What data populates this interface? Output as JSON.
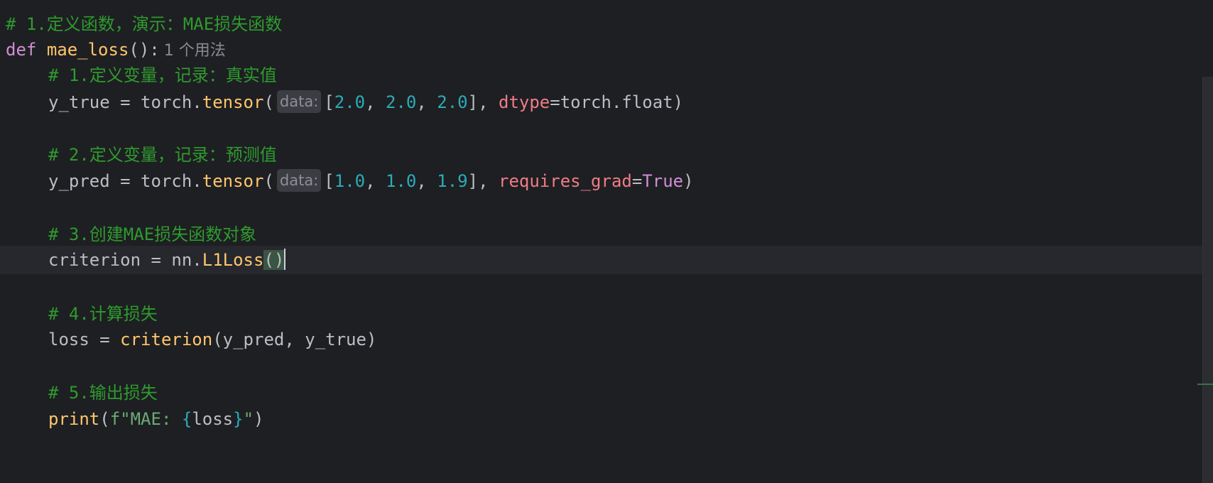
{
  "lines": {
    "l1_comment": "# 1.定义函数，演示：MAE损失函数",
    "l2_def": "def",
    "l2_name": "mae_loss",
    "l2_rest": "():",
    "l2_usage": "1 个用法",
    "l3_comment": "# 1.定义变量，记录：真实值",
    "l4_var": "y_true = torch.",
    "l4_call": "tensor",
    "l4_open": "(",
    "l4_hint": "data:",
    "l4_bracket_open": "[",
    "l4_n1": "2.0",
    "l4_sep1": ", ",
    "l4_n2": "2.0",
    "l4_sep2": ", ",
    "l4_n3": "2.0",
    "l4_bracket_close": "], ",
    "l4_param": "dtype",
    "l4_tail": "=torch.float)",
    "l6_comment": "# 2.定义变量，记录：预测值",
    "l7_var": "y_pred = torch.",
    "l7_call": "tensor",
    "l7_open": "(",
    "l7_hint": "data:",
    "l7_bracket_open": "[",
    "l7_n1": "1.0",
    "l7_sep1": ", ",
    "l7_n2": "1.0",
    "l7_sep2": ", ",
    "l7_n3": "1.9",
    "l7_bracket_close": "], ",
    "l7_param": "requires_grad",
    "l7_eq": "=",
    "l7_bool": "True",
    "l7_close": ")",
    "l9_comment": "# 3.创建MAE损失函数对象",
    "l10_var": "criterion = nn.",
    "l10_call": "L1Loss",
    "l10_open": "(",
    "l10_close": ")",
    "l12_comment": "# 4.计算损失",
    "l13_var": "loss = ",
    "l13_call": "criterion",
    "l13_args": "(y_pred, y_true)",
    "l15_comment": "# 5.输出损失",
    "l16_call": "print",
    "l16_open": "(",
    "l16_str1": "f\"MAE: ",
    "l16_brace_open": "{",
    "l16_expr": "loss",
    "l16_brace_close": "}",
    "l16_str2": "\"",
    "l16_close": ")"
  },
  "colors": {
    "background": "#1e1f22",
    "comment": "#2e9b2e",
    "keyword": "#cf8ed6",
    "function": "#ffc66d",
    "number": "#2aacb8",
    "parameter": "#ef7c87",
    "string": "#6aab73"
  }
}
